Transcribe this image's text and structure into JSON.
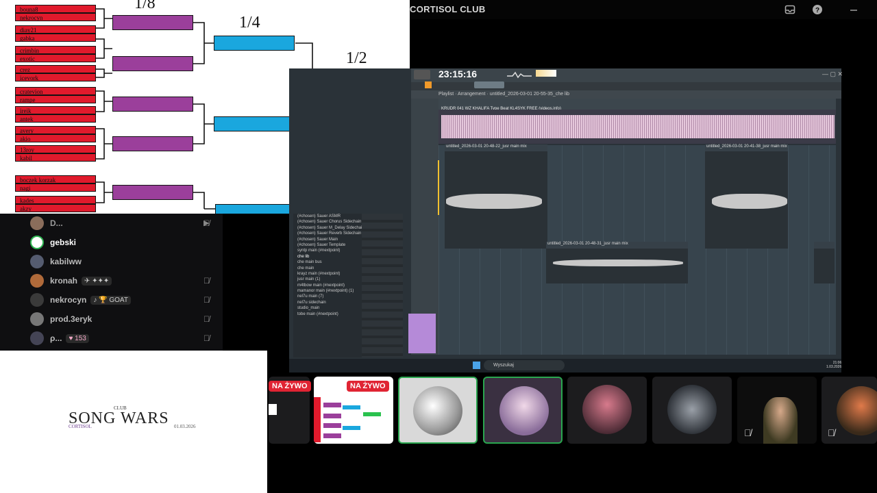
{
  "server": {
    "title": "CORTISOL CLUB"
  },
  "bracket": {
    "round_labels": [
      "1/8",
      "1/4",
      "1/2"
    ],
    "teams": [
      "bouna8",
      "nekrocyn",
      "diay21",
      "gabka",
      "crimbin",
      "exotic",
      "crez",
      "icevork",
      "cratevion",
      "rampe",
      "ireik",
      "antek",
      "avery",
      "akio",
      "13roy",
      "kabil",
      "boczek korzak",
      "nagi",
      "kades",
      "akzy"
    ]
  },
  "members": [
    {
      "name": "D...",
      "badge": ""
    },
    {
      "name": "gebski",
      "badge": ""
    },
    {
      "name": "kabilww",
      "badge": ""
    },
    {
      "name": "kronah",
      "badge": "✈ ✦✦✦"
    },
    {
      "name": "nekrocyn",
      "badge": "♪ 🏆 GOAT"
    },
    {
      "name": "prod.3eryk",
      "badge": ""
    },
    {
      "name": "ρ...",
      "badge": "♥ 153"
    }
  ],
  "song_wars": {
    "club": "CLUB",
    "title": "SONG WARS",
    "brand": "CORTISOL",
    "date": "01.03.2026"
  },
  "fl": {
    "timer": "23:15:16",
    "playlist_title": "Playlist · Arrangement · untitled_2026-03-01 20-55-35_che lib",
    "track1_name": "KRUDR 041 WZ KHALIFA Type Beat KL4SYK FREE (videos.info)",
    "clip_a": "untitled_2026-03-01 20-48-22_jusr main mix",
    "clip_b": "untitled_2026-03-01 20-41-38_jusr main mix",
    "clip_c": "untitled_2026-03-01 20-48-31_jusr main mix",
    "browser": [
      "(#chosen) Sauer ASMR",
      "(#chosen) Sauer Chorus Sidechain",
      "(#chosen) Sauer M_Delay Sidechain",
      "(#chosen) Sauer Reverb Sidechain",
      "(#chosen) Sauer Main",
      "(#chosen) Sauer Template",
      "syntp main (#nextpoint)",
      "che lib",
      "che main bus",
      "che main",
      "krayz main (#nextpoint)",
      "jusr main (1)",
      "m4tbow main (#nextpoint)",
      "mamanor main (#nextpoint) (1)",
      "nel7u main (7)",
      "nel7u sidechain",
      "studio_main",
      "tobe main (#nextpoint)"
    ],
    "search": "Wyszukaj",
    "clock": "21:06",
    "date": "1.03.2026"
  },
  "tiles": {
    "live_label": "NA ŻYWO"
  }
}
